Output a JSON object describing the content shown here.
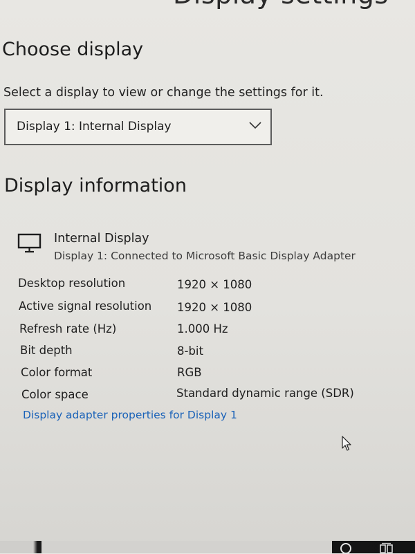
{
  "window": {
    "title": "Display settings"
  },
  "choose_display": {
    "heading": "Choose display",
    "prompt": "Select a display to view or change the settings for it.",
    "dropdown_value": "Display 1: Internal Display"
  },
  "display_info": {
    "heading": "Display information",
    "device_name": "Internal Display",
    "device_sub": "Display 1: Connected to Microsoft Basic Display Adapter",
    "rows": [
      {
        "label": "Desktop resolution",
        "value": "1920 × 1080"
      },
      {
        "label": "Active signal resolution",
        "value": "1920 × 1080"
      },
      {
        "label": "Refresh rate (Hz)",
        "value": "1.000 Hz"
      },
      {
        "label": "Bit depth",
        "value": "8-bit"
      },
      {
        "label": "Color format",
        "value": "RGB"
      },
      {
        "label": "Color space",
        "value": "Standard dynamic range (SDR)"
      }
    ],
    "adapter_link": "Display adapter properties for Display 1"
  },
  "icons": {
    "monitor": "monitor-icon",
    "chevron": "chevron-down-icon",
    "cursor": "mouse-cursor-icon",
    "cortana": "cortana-circle-icon",
    "taskview": "task-view-icon"
  },
  "colors": {
    "link": "#1a62b8",
    "background": "#e5e4e0",
    "text": "#1b1b1b"
  }
}
